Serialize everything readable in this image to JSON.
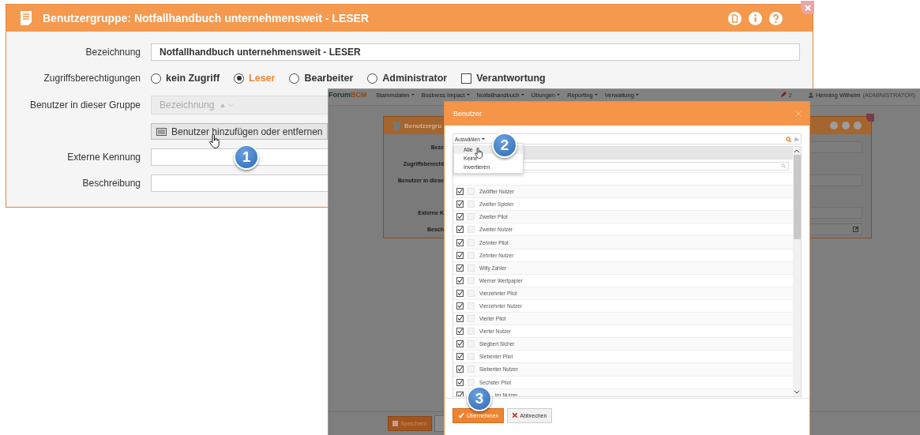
{
  "dialog": {
    "title": "Benutzergruppe: Notfallhandbuch unternehmensweit - LESER",
    "fields": [
      {
        "kind": "text",
        "label": "Bezeichnung",
        "value": "Notfallhandbuch unternehmensweit - LESER"
      },
      {
        "kind": "radio",
        "label": "Zugriffsberechtigungen",
        "options": [
          {
            "label": "kein Zugriff",
            "selected": false
          },
          {
            "label": "Leser",
            "selected": true
          },
          {
            "label": "Bearbeiter",
            "selected": false
          },
          {
            "label": "Administrator",
            "selected": false
          }
        ],
        "checkbox": {
          "label": "Verantwortung",
          "checked": false
        }
      },
      {
        "kind": "table",
        "label": "Benutzer in dieser Gruppe",
        "column": "Bezeichnung",
        "button": "Benutzer hinzufügen oder entfernen"
      },
      {
        "kind": "text",
        "label": "Externe Kennung"
      },
      {
        "kind": "text",
        "label": "Beschreibung"
      }
    ]
  },
  "screenshot": {
    "navbar": {
      "logo": [
        "Forum",
        "BCM"
      ],
      "menu": [
        "Stammdaten",
        "Business Impact",
        "Notfallhandbuch",
        "Übungen",
        "Reporting",
        "Verwaltung"
      ],
      "notifications": "2",
      "user": "Henning Wilhelm",
      "role": "(ADMINISTRATOR)"
    },
    "background_dialog": {
      "title": "Benutzergru",
      "labels": [
        "Beze",
        "Zugriffsberecht",
        "Benutzer in diese",
        "Externe K",
        "Besch"
      ]
    },
    "footer_button": "Speichern",
    "modal": {
      "title": "Benutzer",
      "select_menu": "Auswählen",
      "menu_items": [
        {
          "label": "Alle",
          "selected": true
        },
        {
          "label": "Keine",
          "selected": false
        },
        {
          "label": "Invertieren",
          "selected": false
        }
      ],
      "rows": [
        {
          "label": "Zwölfter Nutzer",
          "checked": true,
          "second_checked": false
        },
        {
          "label": "Zweiter Spieler",
          "checked": true,
          "second_checked": false
        },
        {
          "label": "Zweiter Pilot",
          "checked": true,
          "second_checked": false
        },
        {
          "label": "Zweiter Nutzer",
          "checked": true,
          "second_checked": false
        },
        {
          "label": "Zehnter Pilot",
          "checked": true,
          "second_checked": false
        },
        {
          "label": "Zehnter Nutzer",
          "checked": true,
          "second_checked": false
        },
        {
          "label": "Willy Zahler",
          "checked": true,
          "second_checked": false
        },
        {
          "label": "Werner Wertpapier",
          "checked": true,
          "second_checked": false
        },
        {
          "label": "Vierzehnter Pilot",
          "checked": true,
          "second_checked": false
        },
        {
          "label": "Vierzehnter Nutzer",
          "checked": true,
          "second_checked": false
        },
        {
          "label": "Vierter Pilot",
          "checked": true,
          "second_checked": false
        },
        {
          "label": "Vierter Nutzer",
          "checked": true,
          "second_checked": false
        },
        {
          "label": "Siegbert Sicher",
          "checked": true,
          "second_checked": false
        },
        {
          "label": "Siebenter Pilot",
          "checked": true,
          "second_checked": false
        },
        {
          "label": "Siebenter Nutzer",
          "checked": true,
          "second_checked": false
        },
        {
          "label": "Sechster Pilot",
          "checked": true,
          "second_checked": false
        },
        {
          "label": "ter Nutzer",
          "checked": true
        }
      ],
      "buttons": [
        {
          "kind": "primary",
          "label": "Übernehmen"
        },
        {
          "kind": "cancel",
          "label": "Abbrechen"
        }
      ]
    }
  },
  "callouts": [
    "1",
    "2",
    "3"
  ]
}
